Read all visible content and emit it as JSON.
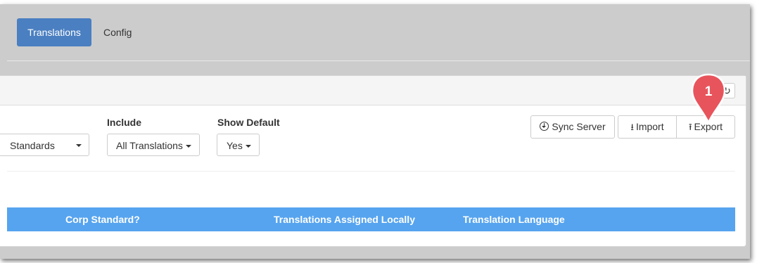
{
  "tabs": {
    "translations": "Translations",
    "config": "Config"
  },
  "filters": {
    "standards": {
      "value": "Standards"
    },
    "include": {
      "label": "Include",
      "value": "All Translations"
    },
    "show_default": {
      "label": "Show Default",
      "value": "Yes"
    }
  },
  "actions": {
    "sync_server": "Sync Server",
    "import": "Import",
    "export": "Export"
  },
  "table": {
    "columns": [
      "Corp Standard?",
      "Translations Assigned Locally",
      "Translation Language"
    ]
  },
  "callout": {
    "number": "1"
  },
  "colors": {
    "active_tab": "#4a7fc1",
    "table_header": "#56a4ef",
    "callout": "#e8545c"
  }
}
